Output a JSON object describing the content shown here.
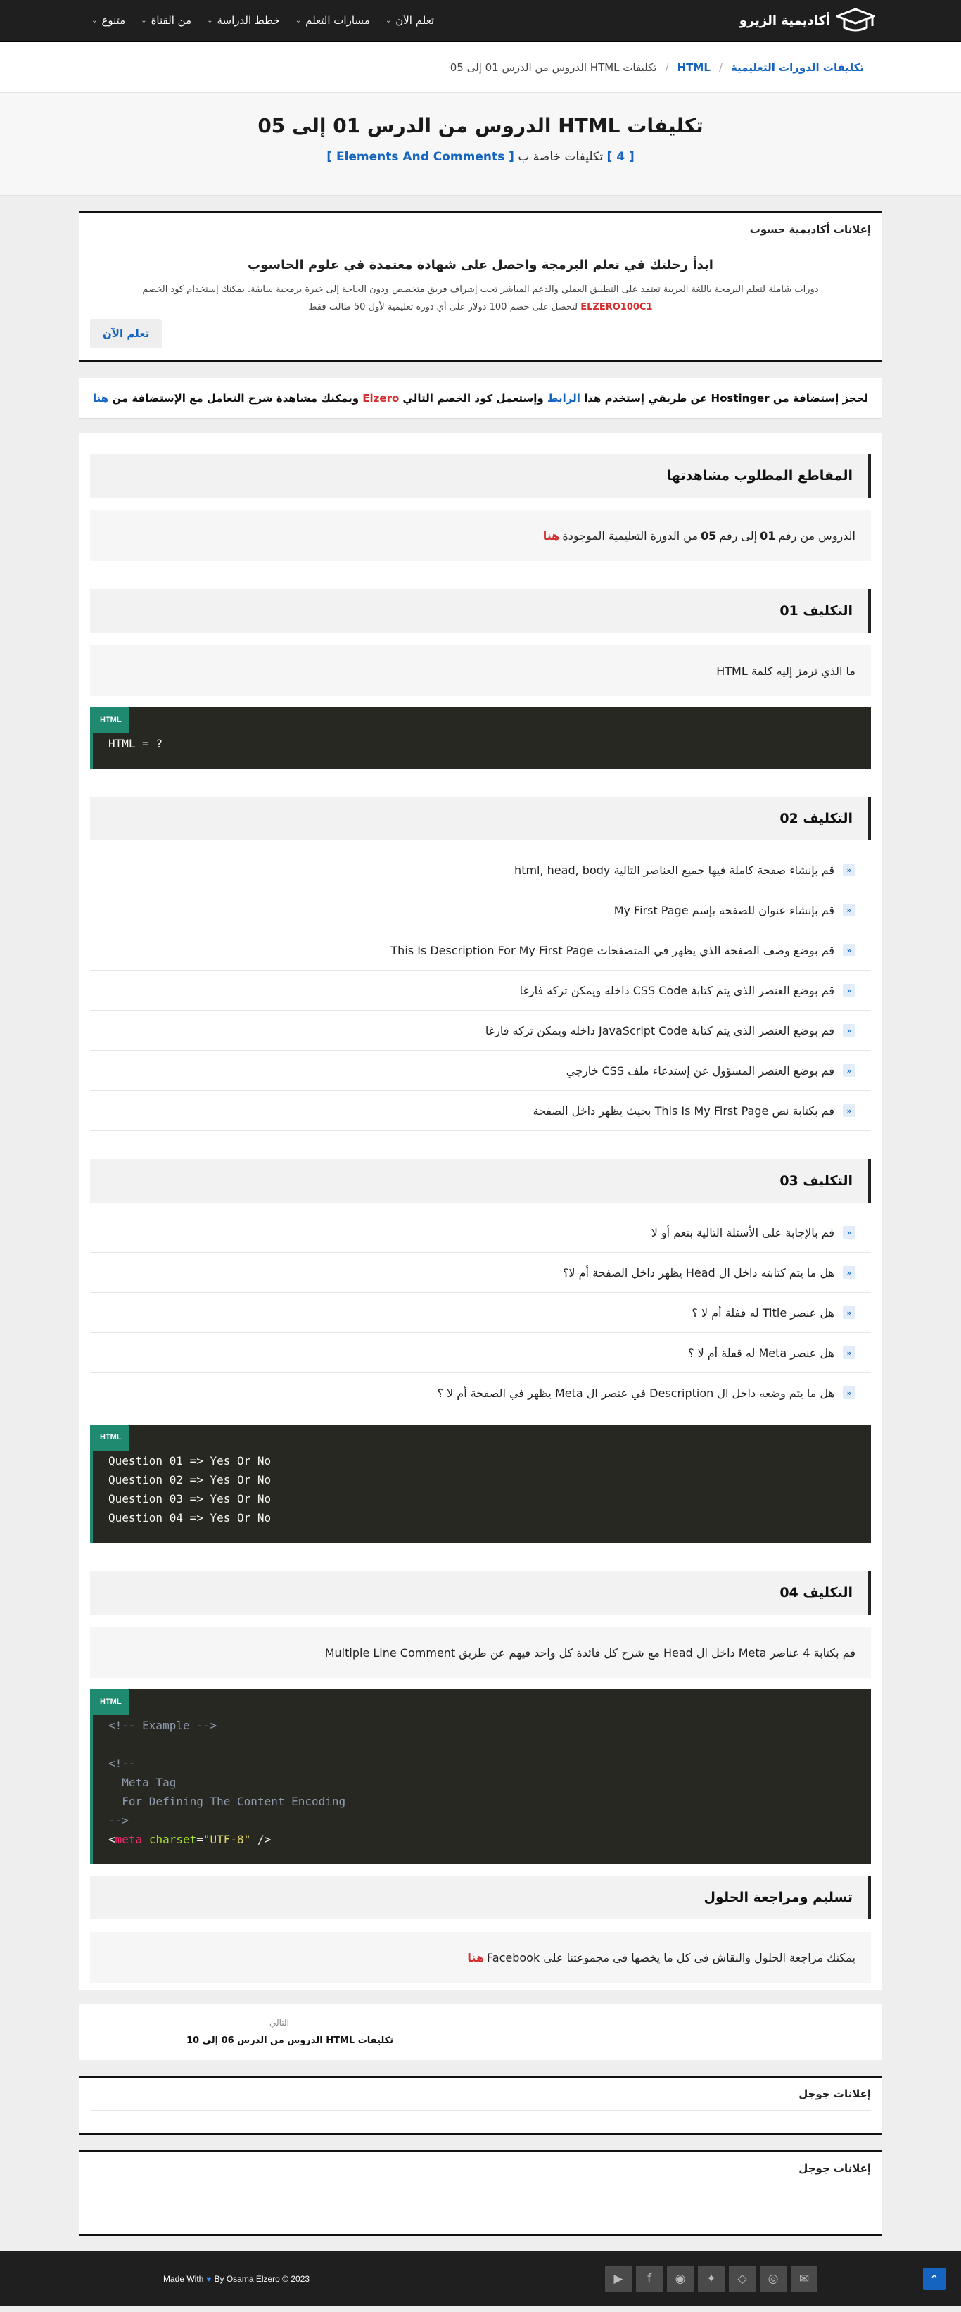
{
  "header": {
    "brand": "أكاديمية الزيرو",
    "nav": [
      "تعلم الآن",
      "مسارات التعلم",
      "خطط الدراسة",
      "من القناة",
      "متنوع"
    ]
  },
  "breadcrumb": {
    "root": "تكليفات الدورات التعليمية",
    "category": "HTML",
    "current": "تكليفات HTML الدروس من الدرس 01 إلى 05"
  },
  "page": {
    "title": "تكليفات HTML الدروس من الدرس 01 إلى 05",
    "sub_prefix": "[ 4 ]",
    "sub_text": "تكليفات خاصة ب",
    "sub_link": "[ Elements And Comments ]"
  },
  "ad": {
    "label": "إعلانات أكاديمية حسوب",
    "title": "ابدأ رحلتك في تعلم البرمجة واحصل على شهادة معتمدة في علوم الحاسوب",
    "text1": "دورات شاملة لتعلم البرمجة باللغة العربية تعتمد على التطبيق العملي والدعم المباشر تحت إشراف فريق متخصص ودون الحاجة إلى خبرة برمجية سابقة. يمكنك إستخدام كود الخصم",
    "code": "ELZERO100C1",
    "text2": "لتحصل على خصم 100 دولار على أي دورة تعليمية لأول 50 طالب فقط",
    "button": "تعلم الآن"
  },
  "hosting": {
    "t1": "لحجز إستضافة من Hostinger عن طريقي إستخدم هذا",
    "link": "الرابط",
    "t2": "وإستعمل كود الخصم التالي",
    "code": "Elzero",
    "t3": "ويمكنك مشاهدة شرح التعامل مع الإستضافة من",
    "here": "هنا"
  },
  "content": {
    "videos_title": "المقاطع المطلوب مشاهدتها",
    "videos_t1": "الدروس من رقم",
    "videos_from": "01",
    "videos_t2": "إلى رقم",
    "videos_to": "05",
    "videos_t3": "من الدورة التعليمية الموجودة",
    "videos_here": "هنا",
    "a1_title": "التكليف 01",
    "a1_text": "ما الذي ترمز إليه كلمة HTML",
    "a1_code_tag": "HTML",
    "a1_code": "HTML = ?",
    "a2_title": "التكليف 02",
    "a2_items": [
      "قم بإنشاء صفحة كاملة فيها جميع العناصر التالية html, head, body",
      "قم بإنشاء عنوان للصفحة بإسم My First Page",
      "قم بوضع وصف الصفحة الذي يظهر في المتصفحات This Is Description For My First Page",
      "قم بوضع العنصر الذي يتم كتابة CSS Code داخله ويمكن تركه فارغا",
      "قم بوضع العنصر الذي يتم كتابة JavaScript Code داخله ويمكن تركه فارغا",
      "قم بوضع العنصر المسؤول عن إستدعاء ملف CSS خارجي",
      "قم بكتابة نص This Is My First Page بحيث يظهر داخل الصفحة"
    ],
    "a3_title": "التكليف 03",
    "a3_items": [
      "قم بالإجابة على الأسئلة التالية بنعم أو لا",
      "هل ما يتم كتابته داخل ال Head يظهر داخل الصفحة أم لا؟",
      "هل عنصر Title له قفلة أم لا ؟",
      "هل عنصر Meta له قفلة أم لا ؟",
      "هل ما يتم وضعه داخل ال Description في عنصر ال Meta يظهر في الصفحة أم لا ؟"
    ],
    "a3_code_tag": "HTML",
    "a3_code": [
      "Question 01 => Yes Or No",
      "Question 02 => Yes Or No",
      "Question 03 => Yes Or No",
      "Question 04 => Yes Or No"
    ],
    "a4_title": "التكليف 04",
    "a4_text": "قم بكتابة 4 عناصر Meta داخل ال Head مع شرح كل فائدة كل واحد فيهم عن طريق Multiple Line Comment",
    "a4_code_tag": "HTML",
    "a4_code": {
      "l1": "<!-- Example -->",
      "l2": "<!--",
      "l3": "  Meta Tag",
      "l4": "  For Defining The Content Encoding",
      "l5": "-->",
      "tag_open": "<",
      "tag_name": "meta",
      "attr": "charset",
      "eq": "=",
      "value": "\"UTF-8\"",
      "tag_close": " />"
    },
    "submit_title": "تسليم ومراجعة الحلول",
    "submit_text": "يمكنك مراجعة الحلول والنقاش في كل ما يخصها في مجموعتنا على Facebook",
    "submit_here": "هنا"
  },
  "next": {
    "label": "التالي",
    "title": "تكليفات HTML الدروس من الدرس 06 إلى 10"
  },
  "google_ads": [
    "إعلانات جوجل",
    "إعلانات جوجل"
  ],
  "footer": {
    "made": "Made With",
    "by": "By Osama Elzero © 2023",
    "socials": [
      "youtube-icon",
      "facebook-icon",
      "github-icon",
      "twitter-icon",
      "codepen-icon",
      "instagram-icon",
      "email-icon"
    ]
  }
}
